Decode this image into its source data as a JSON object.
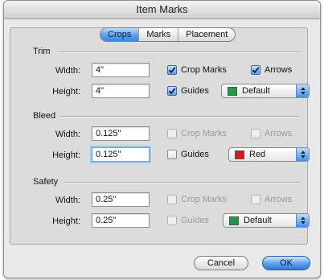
{
  "window": {
    "title": "Item Marks"
  },
  "tabs": [
    {
      "label": "Crops",
      "active": true
    },
    {
      "label": "Marks",
      "active": false
    },
    {
      "label": "Placement",
      "active": false
    }
  ],
  "sections": [
    {
      "title": "Trim",
      "width_label": "Width:",
      "width_value": "4\"",
      "height_label": "Height:",
      "height_value": "4\"",
      "crop_marks": {
        "label": "Crop Marks",
        "checked": true
      },
      "arrows": {
        "label": "Arrows",
        "checked": true
      },
      "guides": {
        "label": "Guides",
        "checked": true
      },
      "color": {
        "label": "Default",
        "swatch": "#1e9a4a"
      }
    },
    {
      "title": "Bleed",
      "width_label": "Width:",
      "width_value": "0.125\"",
      "height_label": "Height:",
      "height_value": "0.125\"",
      "crop_marks": {
        "label": "Crop Marks",
        "checked": false
      },
      "arrows": {
        "label": "Arrows",
        "checked": false
      },
      "guides": {
        "label": "Guides",
        "checked": false
      },
      "color": {
        "label": "Red",
        "swatch": "#e0141e"
      }
    },
    {
      "title": "Safety",
      "width_label": "Width:",
      "width_value": "0.25\"",
      "height_label": "Height:",
      "height_value": "0.25\"",
      "crop_marks": {
        "label": "Crop Marks",
        "checked": false
      },
      "arrows": {
        "label": "Arrows",
        "checked": false
      },
      "guides": {
        "label": "Guides",
        "checked": false
      },
      "color": {
        "label": "Default",
        "swatch": "#1e9a4a"
      }
    }
  ],
  "buttons": {
    "cancel": "Cancel",
    "ok": "OK"
  }
}
